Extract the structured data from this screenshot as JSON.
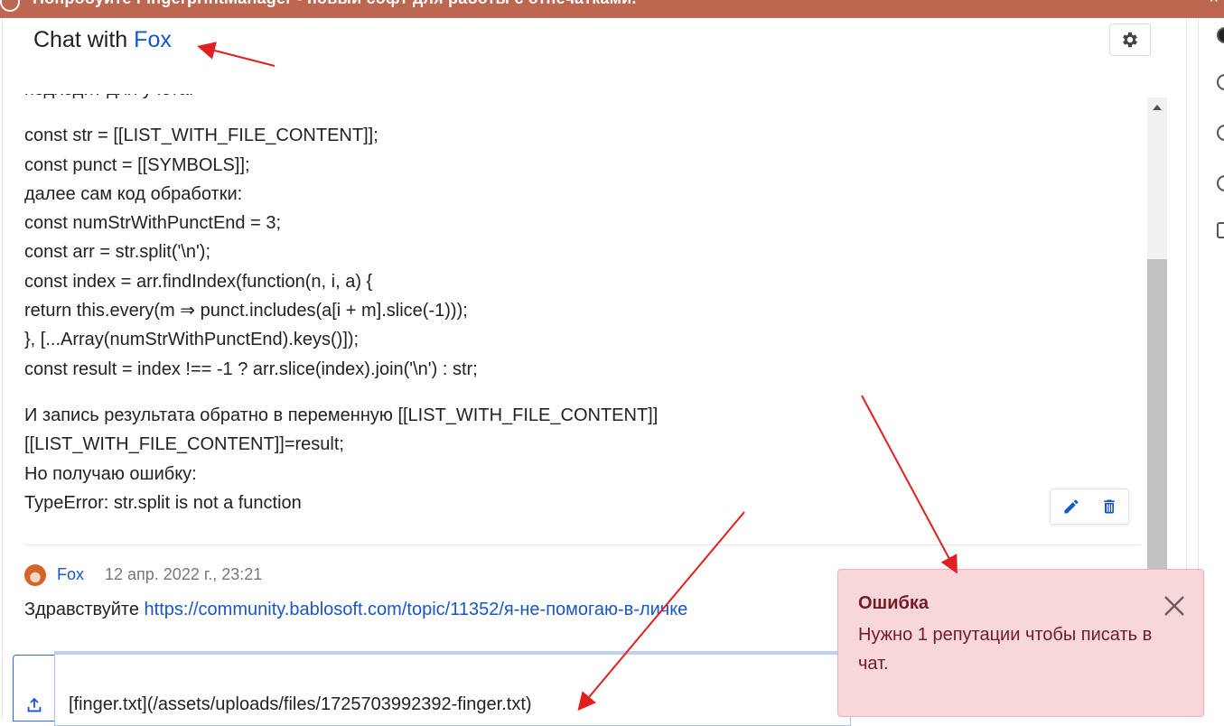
{
  "banner": {
    "text": "Попробуйте FingerprintManager - новый софт для работы с отпечатками.",
    "right_glyph": "×"
  },
  "chat": {
    "title_prefix": "Chat with ",
    "title_user": "Fox",
    "settings_icon": "gear-icon"
  },
  "message1": {
    "lines": [
      "подходит для учета.",
      "",
      "const str = [[LIST_WITH_FILE_CONTENT]];",
      "const punct = [[SYMBOLS]];",
      "далее сам код обработки:",
      "const numStrWithPunctEnd = 3;",
      "const arr = str.split('\\n');",
      "const index = arr.findIndex(function(n, i, a) {",
      "return this.every(m ⇒ punct.includes(a[i + m].slice(-1)));",
      "}, [...Array(numStrWithPunctEnd).keys()]);",
      "const result = index !== -1 ? arr.slice(index).join('\\n') : str;",
      "",
      "И запись результата обратно в переменную [[LIST_WITH_FILE_CONTENT]]",
      "[[LIST_WITH_FILE_CONTENT]]=result;",
      "Но получаю ошибку:",
      "TypeError: str.split is not a function"
    ],
    "actions": {
      "edit_icon": "pencil-icon",
      "delete_icon": "trash-icon"
    }
  },
  "message2": {
    "author": "Fox",
    "timestamp": "12 апр. 2022 г., 23:21",
    "greeting": "Здравствуйте ",
    "link": "https://community.bablosoft.com/topic/11352/я-не-помогаю-в-личке"
  },
  "composer": {
    "upload_icon": "upload-icon",
    "value": "[finger.txt](/assets/uploads/files/1725703992392-finger.txt)"
  },
  "toast": {
    "title": "Ошибка",
    "message": "Нужно 1 репутации чтобы писать в чат.",
    "close_icon": "close-icon"
  },
  "colors": {
    "banner": "#bd6650",
    "link": "#1a56c4",
    "toast_bg": "#f8d7da",
    "toast_text": "#721c24",
    "annotation_arrow": "#e02020"
  }
}
